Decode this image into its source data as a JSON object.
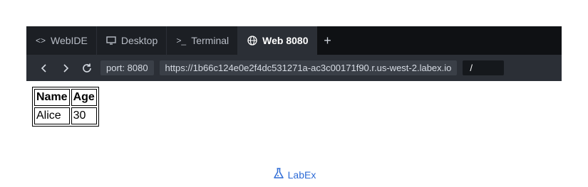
{
  "tabs": [
    {
      "label": "WebIDE",
      "icon": "code-icon",
      "active": false
    },
    {
      "label": "Desktop",
      "icon": "monitor-icon",
      "active": false
    },
    {
      "label": "Terminal",
      "icon": "terminal-icon",
      "active": false
    },
    {
      "label": "Web 8080",
      "icon": "globe-icon",
      "active": true
    }
  ],
  "new_tab_label": "+",
  "address": {
    "port": "port: 8080",
    "url": "https://1b66c124e0e2f4dc531271a-ac3c00171f90.r.us-west-2.labex.io",
    "path": "/"
  },
  "table": {
    "headers": [
      "Name",
      "Age"
    ],
    "rows": [
      [
        "Alice",
        "30"
      ]
    ]
  },
  "footer": {
    "brand": "LabEx",
    "accent": "#2d6bd6"
  }
}
